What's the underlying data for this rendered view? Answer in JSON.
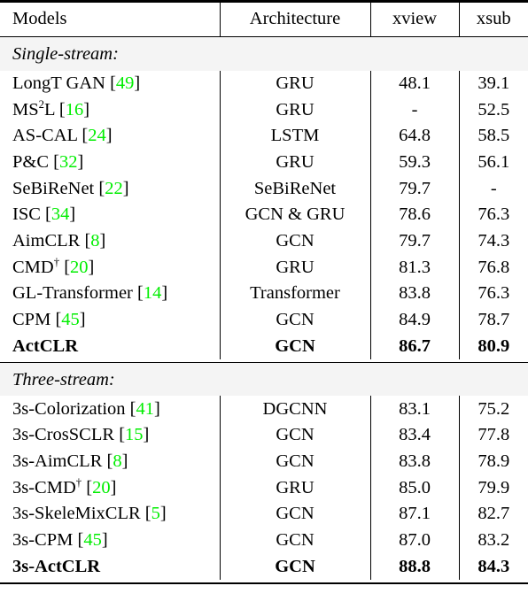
{
  "table": {
    "columns": [
      {
        "key": "model",
        "label": "Models",
        "align": "left"
      },
      {
        "key": "architecture",
        "label": "Architecture",
        "align": "center"
      },
      {
        "key": "xview",
        "label": "xview",
        "align": "center"
      },
      {
        "key": "xsub",
        "label": "xsub",
        "align": "center"
      }
    ],
    "citation_color": "#00ee00",
    "sections": [
      {
        "title": "Single-stream:",
        "rows": [
          {
            "model": "LongT GAN",
            "citation": "49",
            "architecture": "GRU",
            "xview": "48.1",
            "xsub": "39.1",
            "bold": false
          },
          {
            "model": "MS2L",
            "model_superscript": "2",
            "citation": "16",
            "architecture": "GRU",
            "xview": "-",
            "xsub": "52.5",
            "bold": false
          },
          {
            "model": "AS-CAL",
            "citation": "24",
            "architecture": "LSTM",
            "xview": "64.8",
            "xsub": "58.5",
            "bold": false
          },
          {
            "model": "P&C",
            "citation": "32",
            "architecture": "GRU",
            "xview": "59.3",
            "xsub": "56.1",
            "bold": false
          },
          {
            "model": "SeBiReNet",
            "citation": "22",
            "architecture": "SeBiReNet",
            "xview": "79.7",
            "xsub": "-",
            "bold": false
          },
          {
            "model": "ISC",
            "citation": "34",
            "architecture": "GCN & GRU",
            "xview": "78.6",
            "xsub": "76.3",
            "bold": false
          },
          {
            "model": "AimCLR",
            "citation": "8",
            "architecture": "GCN",
            "xview": "79.7",
            "xsub": "74.3",
            "bold": false
          },
          {
            "model": "CMD",
            "model_dagger": "†",
            "citation": "20",
            "architecture": "GRU",
            "xview": "81.3",
            "xsub": "76.8",
            "bold": false
          },
          {
            "model": "GL-Transformer",
            "citation": "14",
            "architecture": "Transformer",
            "xview": "83.8",
            "xsub": "76.3",
            "bold": false
          },
          {
            "model": "CPM",
            "citation": "45",
            "architecture": "GCN",
            "xview": "84.9",
            "xsub": "78.7",
            "bold": false
          },
          {
            "model": "ActCLR",
            "citation": null,
            "architecture": "GCN",
            "xview": "86.7",
            "xsub": "80.9",
            "bold": true
          }
        ]
      },
      {
        "title": "Three-stream:",
        "rows": [
          {
            "model": "3s-Colorization",
            "citation": "41",
            "architecture": "DGCNN",
            "xview": "83.1",
            "xsub": "75.2",
            "bold": false
          },
          {
            "model": "3s-CrosSCLR",
            "citation": "15",
            "architecture": "GCN",
            "xview": "83.4",
            "xsub": "77.8",
            "bold": false
          },
          {
            "model": "3s-AimCLR",
            "citation": "8",
            "architecture": "GCN",
            "xview": "83.8",
            "xsub": "78.9",
            "bold": false
          },
          {
            "model": "3s-CMD",
            "model_dagger": "†",
            "citation": "20",
            "architecture": "GRU",
            "xview": "85.0",
            "xsub": "79.9",
            "bold": false
          },
          {
            "model": "3s-SkeleMixCLR",
            "citation": "5",
            "architecture": "GCN",
            "xview": "87.1",
            "xsub": "82.7",
            "bold": false
          },
          {
            "model": "3s-CPM",
            "citation": "45",
            "architecture": "GCN",
            "xview": "87.0",
            "xsub": "83.2",
            "bold": false
          },
          {
            "model": "3s-ActCLR",
            "citation": null,
            "architecture": "GCN",
            "xview": "88.8",
            "xsub": "84.3",
            "bold": true
          }
        ]
      }
    ]
  }
}
